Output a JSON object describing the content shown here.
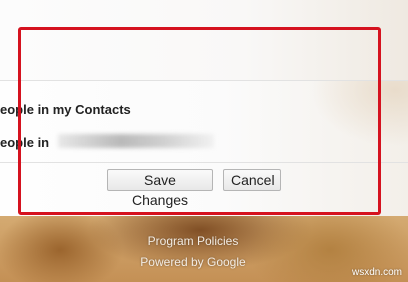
{
  "settings": {
    "row1_text": "eople in my Contacts",
    "row2_text": "eople in"
  },
  "buttons": {
    "save_label": "Save Changes",
    "cancel_label": "Cancel"
  },
  "footer": {
    "program_policies": "Program Policies",
    "powered_by": "Powered by Google"
  },
  "watermark": "wsxdn.com",
  "colors": {
    "highlight_frame": "#d5121f"
  }
}
